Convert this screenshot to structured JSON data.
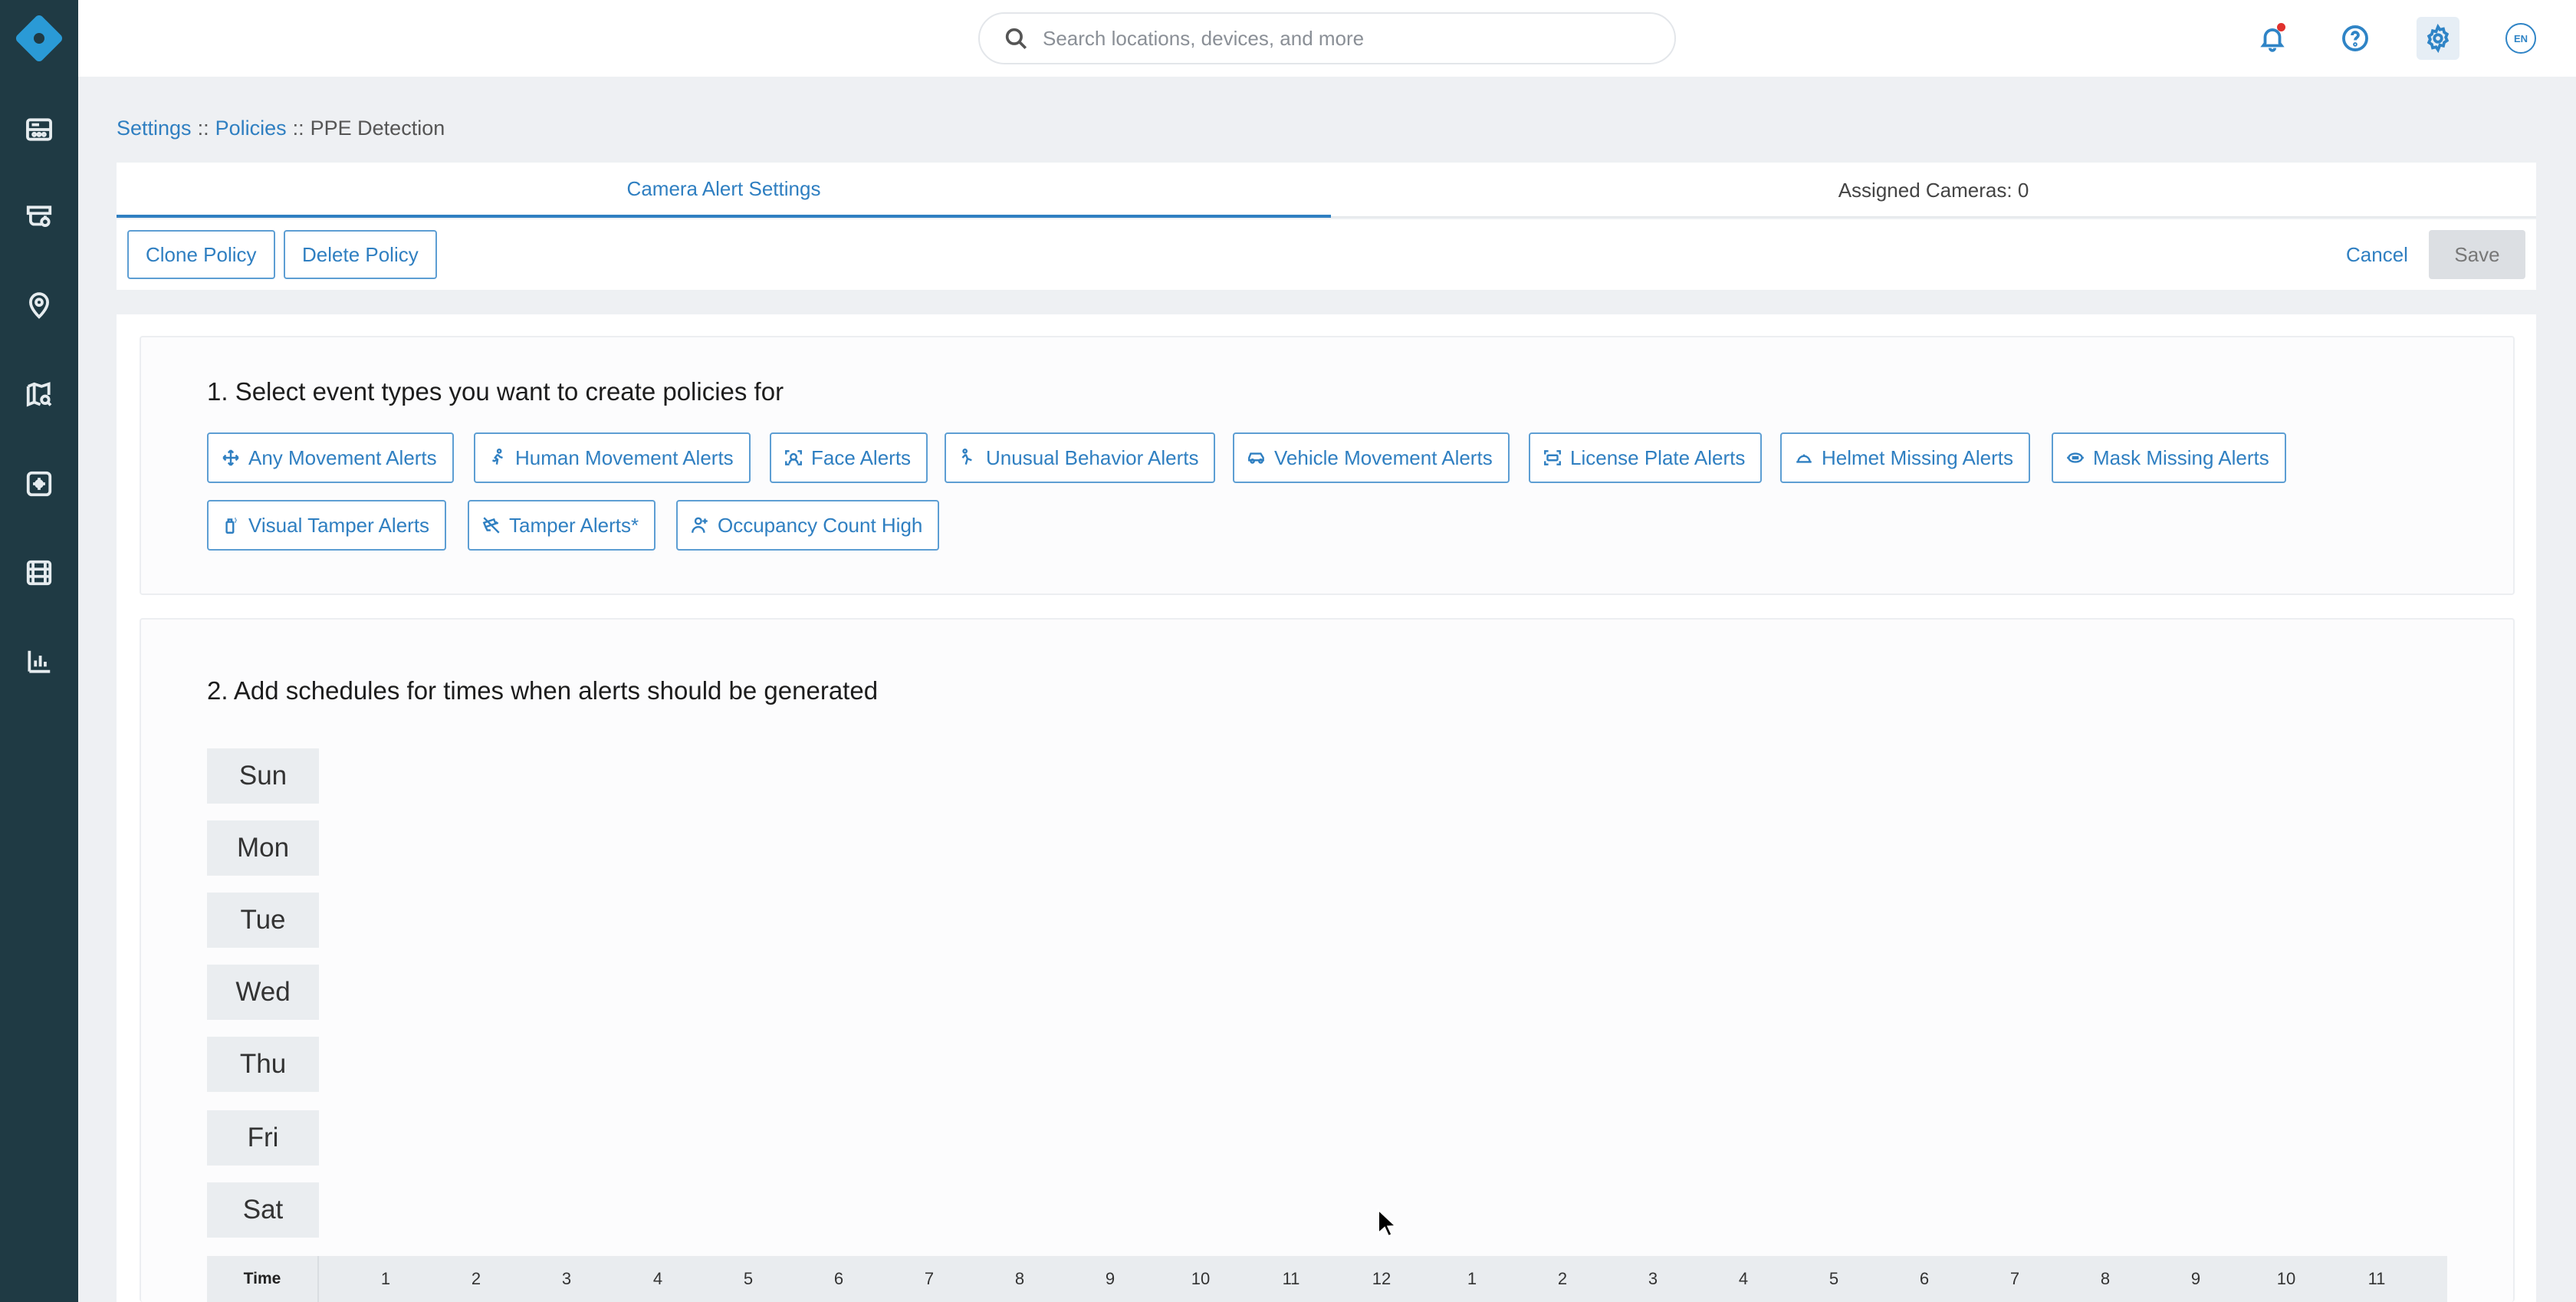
{
  "sidebar": {
    "items": [
      {
        "name": "dashboard",
        "icon": "dashboard-icon"
      },
      {
        "name": "devices",
        "icon": "camera-devices-icon"
      },
      {
        "name": "locations",
        "icon": "location-pin-icon"
      },
      {
        "name": "map-search",
        "icon": "map-search-icon"
      },
      {
        "name": "analytics-ai",
        "icon": "ai-chip-icon"
      },
      {
        "name": "video",
        "icon": "film-icon"
      },
      {
        "name": "reports",
        "icon": "bar-chart-icon"
      }
    ]
  },
  "header": {
    "search_placeholder": "Search locations, devices, and more",
    "lang": "EN"
  },
  "breadcrumb": {
    "settings": "Settings",
    "policies": "Policies",
    "current": "PPE Detection",
    "separator": "::"
  },
  "tabs": [
    {
      "label": "Camera Alert Settings",
      "active": true
    },
    {
      "label": "Assigned Cameras: 0",
      "active": false
    }
  ],
  "toolbar": {
    "clone_label": "Clone Policy",
    "delete_label": "Delete Policy",
    "cancel_label": "Cancel",
    "save_label": "Save"
  },
  "section1": {
    "title": "1. Select event types you want to create policies for",
    "chips": [
      {
        "label": "Any Movement Alerts",
        "icon": "move-arrows-icon"
      },
      {
        "label": "Human Movement Alerts",
        "icon": "running-person-icon"
      },
      {
        "label": "Face Alerts",
        "icon": "face-scan-icon"
      },
      {
        "label": "Unusual Behavior Alerts",
        "icon": "falling-person-icon"
      },
      {
        "label": "Vehicle Movement Alerts",
        "icon": "car-icon"
      },
      {
        "label": "License Plate Alerts",
        "icon": "license-plate-icon"
      },
      {
        "label": "Helmet Missing Alerts",
        "icon": "helmet-icon"
      },
      {
        "label": "Mask Missing Alerts",
        "icon": "mask-icon"
      },
      {
        "label": "Visual Tamper Alerts",
        "icon": "spray-can-icon"
      },
      {
        "label": "Tamper Alerts*",
        "icon": "tamper-camera-icon"
      },
      {
        "label": "Occupancy Count High",
        "icon": "occupancy-person-icon"
      }
    ]
  },
  "section2": {
    "title": "2. Add schedules for times when alerts should be generated",
    "days": [
      "Sun",
      "Mon",
      "Tue",
      "Wed",
      "Thu",
      "Fri",
      "Sat"
    ],
    "time_label": "Time",
    "hours": [
      "1",
      "2",
      "3",
      "4",
      "5",
      "6",
      "7",
      "8",
      "9",
      "10",
      "11",
      "12",
      "1",
      "2",
      "3",
      "4",
      "5",
      "6",
      "7",
      "8",
      "9",
      "10",
      "11"
    ]
  },
  "colors": {
    "sidebar": "#1f3a44",
    "accent": "#2f7fc1",
    "logo": "#2a9ad6",
    "notification_dot": "#e0312d"
  }
}
